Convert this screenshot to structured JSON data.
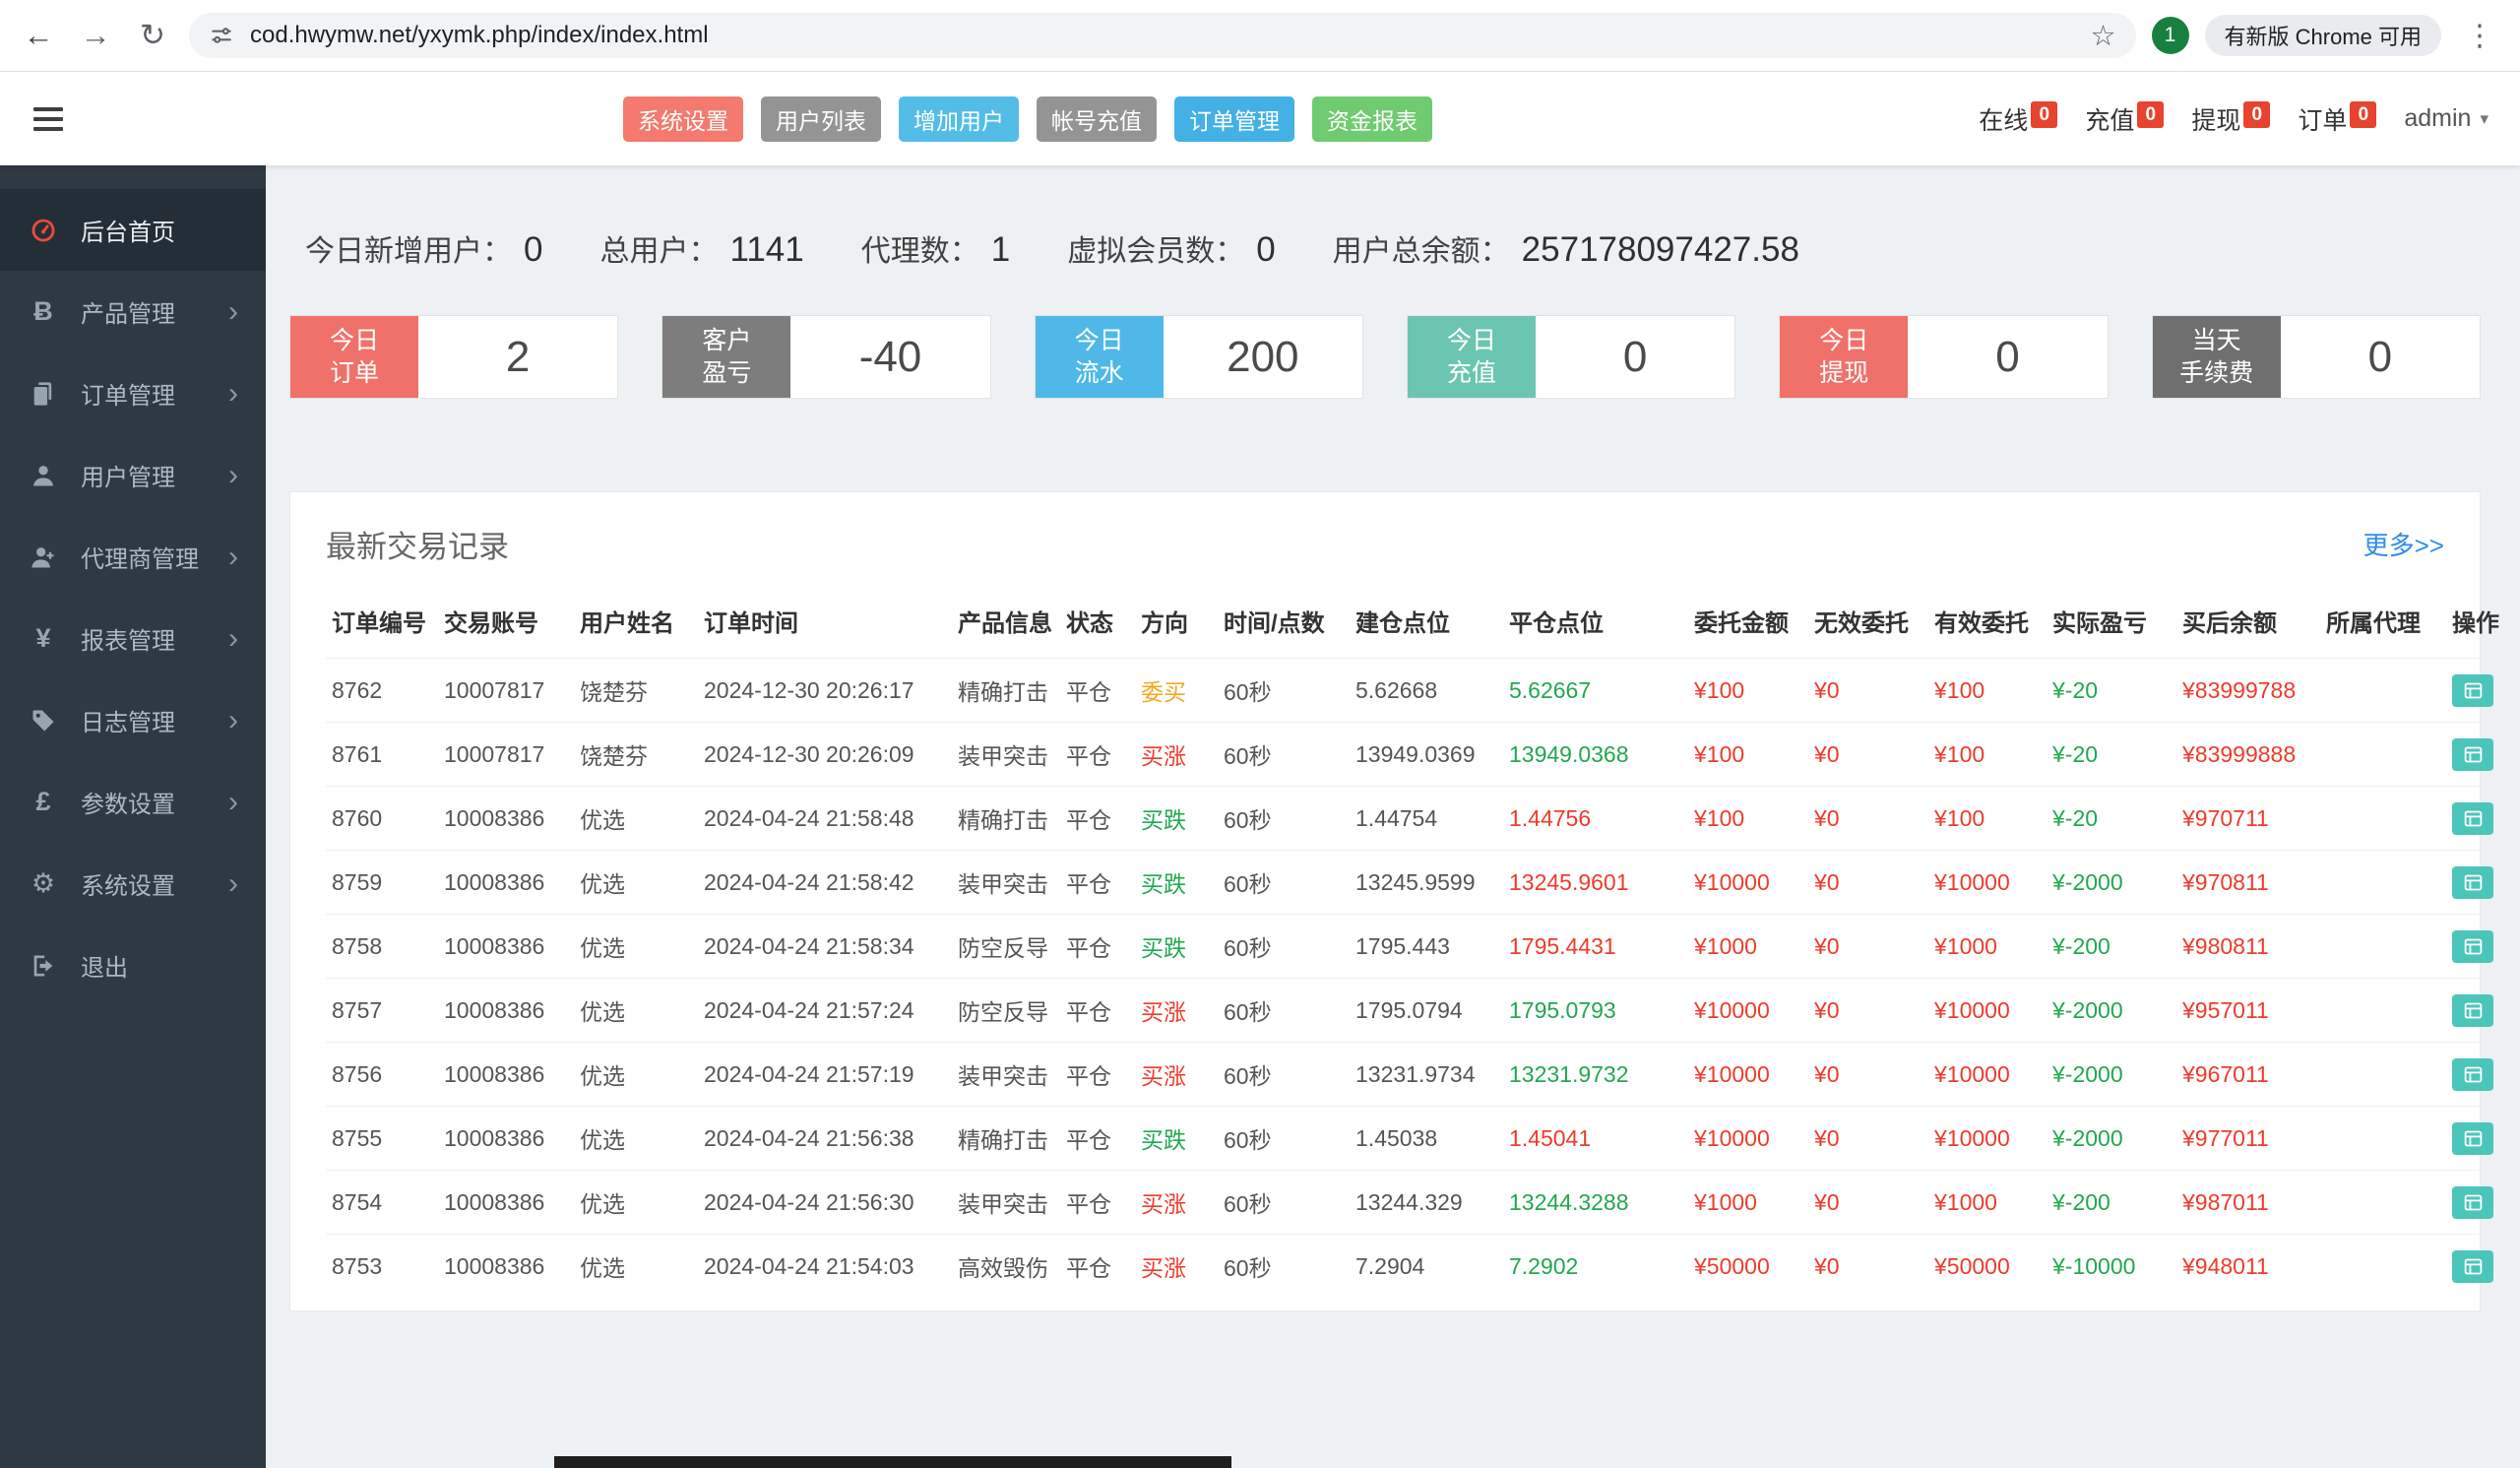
{
  "browser": {
    "url": "cod.hwymw.net/yxymk.php/index/index.html",
    "profile_initial": "1",
    "update_label": "有新版 Chrome 可用"
  },
  "header": {
    "quick_actions": [
      {
        "id": "system-settings",
        "label": "系统设置",
        "color": "#f4796e"
      },
      {
        "id": "user-list",
        "label": "用户列表",
        "color": "#949494"
      },
      {
        "id": "add-user",
        "label": "增加用户",
        "color": "#53bde8"
      },
      {
        "id": "account-recharge",
        "label": "帐号充值",
        "color": "#949494"
      },
      {
        "id": "order-management",
        "label": "订单管理",
        "color": "#43b0e6"
      },
      {
        "id": "funds-report",
        "label": "资金报表",
        "color": "#6fcb6f"
      }
    ],
    "status_items": [
      {
        "id": "online",
        "label": "在线",
        "count": "0"
      },
      {
        "id": "recharge",
        "label": "充值",
        "count": "0"
      },
      {
        "id": "withdraw",
        "label": "提现",
        "count": "0"
      },
      {
        "id": "orders",
        "label": "订单",
        "count": "0"
      }
    ],
    "user_menu": {
      "label": "admin"
    }
  },
  "sidebar": {
    "items": [
      {
        "id": "home",
        "label": "后台首页",
        "icon": "dashboard-icon",
        "active": true,
        "expandable": false
      },
      {
        "id": "products",
        "label": "产品管理",
        "icon": "bitcoin-icon",
        "active": false,
        "expandable": true
      },
      {
        "id": "orders",
        "label": "订单管理",
        "icon": "orders-icon",
        "active": false,
        "expandable": true
      },
      {
        "id": "users",
        "label": "用户管理",
        "icon": "users-icon",
        "active": false,
        "expandable": true
      },
      {
        "id": "agents",
        "label": "代理商管理",
        "icon": "agents-icon",
        "active": false,
        "expandable": true
      },
      {
        "id": "reports",
        "label": "报表管理",
        "icon": "reports-icon",
        "active": false,
        "expandable": true
      },
      {
        "id": "logs",
        "label": "日志管理",
        "icon": "logs-icon",
        "active": false,
        "expandable": true
      },
      {
        "id": "params",
        "label": "参数设置",
        "icon": "params-icon",
        "active": false,
        "expandable": true
      },
      {
        "id": "system",
        "label": "系统设置",
        "icon": "system-icon",
        "active": false,
        "expandable": true
      },
      {
        "id": "logout",
        "label": "退出",
        "icon": "logout-icon",
        "active": false,
        "expandable": false
      }
    ]
  },
  "stats": [
    {
      "label": "今日新增用户：",
      "value": "0"
    },
    {
      "label": "总用户：",
      "value": "1141"
    },
    {
      "label": "代理数：",
      "value": "1"
    },
    {
      "label": "虚拟会员数：",
      "value": "0"
    },
    {
      "label": "用户总余额：",
      "value": "257178097427.58"
    }
  ],
  "cards": [
    {
      "id": "today-orders",
      "lines": [
        "今日",
        "订单"
      ],
      "color": "#f0716a",
      "value": "2"
    },
    {
      "id": "customer-pnl",
      "lines": [
        "客户",
        "盈亏"
      ],
      "color": "#7d7d7d",
      "value": "-40"
    },
    {
      "id": "today-turnover",
      "lines": [
        "今日",
        "流水"
      ],
      "color": "#4fb8e8",
      "value": "200"
    },
    {
      "id": "today-recharge",
      "lines": [
        "今日",
        "充值"
      ],
      "color": "#6cc5b1",
      "value": "0"
    },
    {
      "id": "today-withdraw",
      "lines": [
        "今日",
        "提现"
      ],
      "color": "#f0716a",
      "value": "0"
    },
    {
      "id": "today-fees",
      "lines": [
        "当天",
        "手续费"
      ],
      "color": "#6f6f6f",
      "value": "0"
    }
  ],
  "table": {
    "title": "最新交易记录",
    "more_label": "更多>>",
    "columns": [
      {
        "key": "id",
        "label": "订单编号"
      },
      {
        "key": "account",
        "label": "交易账号"
      },
      {
        "key": "name",
        "label": "用户姓名"
      },
      {
        "key": "time",
        "label": "订单时间"
      },
      {
        "key": "product",
        "label": "产品信息"
      },
      {
        "key": "status",
        "label": "状态"
      },
      {
        "key": "direction",
        "label": "方向",
        "colorKey": "direction_color"
      },
      {
        "key": "period",
        "label": "时间/点数"
      },
      {
        "key": "open",
        "label": "建仓点位"
      },
      {
        "key": "close",
        "label": "平仓点位",
        "colorKey": "close_color"
      },
      {
        "key": "amount",
        "label": "委托金额",
        "color": "red"
      },
      {
        "key": "invalid",
        "label": "无效委托",
        "color": "red"
      },
      {
        "key": "valid",
        "label": "有效委托",
        "color": "red"
      },
      {
        "key": "profit",
        "label": "实际盈亏",
        "color": "green"
      },
      {
        "key": "balance",
        "label": "买后余额",
        "color": "red"
      },
      {
        "key": "agent",
        "label": "所属代理"
      },
      {
        "key": "action",
        "label": "操作"
      }
    ],
    "rows": [
      {
        "id": "8762",
        "account": "10007817",
        "name": "饶楚芬",
        "time": "2024-12-30 20:26:17",
        "product": "精确打击",
        "status": "平仓",
        "direction": "委买",
        "direction_color": "orange",
        "period": "60秒",
        "open": "5.62668",
        "close": "5.62667",
        "close_color": "green",
        "amount": "¥100",
        "invalid": "¥0",
        "valid": "¥100",
        "profit": "¥-20",
        "balance": "¥83999788",
        "agent": ""
      },
      {
        "id": "8761",
        "account": "10007817",
        "name": "饶楚芬",
        "time": "2024-12-30 20:26:09",
        "product": "装甲突击",
        "status": "平仓",
        "direction": "买涨",
        "direction_color": "red",
        "period": "60秒",
        "open": "13949.0369",
        "close": "13949.0368",
        "close_color": "green",
        "amount": "¥100",
        "invalid": "¥0",
        "valid": "¥100",
        "profit": "¥-20",
        "balance": "¥83999888",
        "agent": ""
      },
      {
        "id": "8760",
        "account": "10008386",
        "name": "优选",
        "time": "2024-04-24 21:58:48",
        "product": "精确打击",
        "status": "平仓",
        "direction": "买跌",
        "direction_color": "green",
        "period": "60秒",
        "open": "1.44754",
        "close": "1.44756",
        "close_color": "red",
        "amount": "¥100",
        "invalid": "¥0",
        "valid": "¥100",
        "profit": "¥-20",
        "balance": "¥970711",
        "agent": ""
      },
      {
        "id": "8759",
        "account": "10008386",
        "name": "优选",
        "time": "2024-04-24 21:58:42",
        "product": "装甲突击",
        "status": "平仓",
        "direction": "买跌",
        "direction_color": "green",
        "period": "60秒",
        "open": "13245.9599",
        "close": "13245.9601",
        "close_color": "red",
        "amount": "¥10000",
        "invalid": "¥0",
        "valid": "¥10000",
        "profit": "¥-2000",
        "balance": "¥970811",
        "agent": ""
      },
      {
        "id": "8758",
        "account": "10008386",
        "name": "优选",
        "time": "2024-04-24 21:58:34",
        "product": "防空反导",
        "status": "平仓",
        "direction": "买跌",
        "direction_color": "green",
        "period": "60秒",
        "open": "1795.443",
        "close": "1795.4431",
        "close_color": "red",
        "amount": "¥1000",
        "invalid": "¥0",
        "valid": "¥1000",
        "profit": "¥-200",
        "balance": "¥980811",
        "agent": ""
      },
      {
        "id": "8757",
        "account": "10008386",
        "name": "优选",
        "time": "2024-04-24 21:57:24",
        "product": "防空反导",
        "status": "平仓",
        "direction": "买涨",
        "direction_color": "red",
        "period": "60秒",
        "open": "1795.0794",
        "close": "1795.0793",
        "close_color": "green",
        "amount": "¥10000",
        "invalid": "¥0",
        "valid": "¥10000",
        "profit": "¥-2000",
        "balance": "¥957011",
        "agent": ""
      },
      {
        "id": "8756",
        "account": "10008386",
        "name": "优选",
        "time": "2024-04-24 21:57:19",
        "product": "装甲突击",
        "status": "平仓",
        "direction": "买涨",
        "direction_color": "red",
        "period": "60秒",
        "open": "13231.9734",
        "close": "13231.9732",
        "close_color": "green",
        "amount": "¥10000",
        "invalid": "¥0",
        "valid": "¥10000",
        "profit": "¥-2000",
        "balance": "¥967011",
        "agent": ""
      },
      {
        "id": "8755",
        "account": "10008386",
        "name": "优选",
        "time": "2024-04-24 21:56:38",
        "product": "精确打击",
        "status": "平仓",
        "direction": "买跌",
        "direction_color": "green",
        "period": "60秒",
        "open": "1.45038",
        "close": "1.45041",
        "close_color": "red",
        "amount": "¥10000",
        "invalid": "¥0",
        "valid": "¥10000",
        "profit": "¥-2000",
        "balance": "¥977011",
        "agent": ""
      },
      {
        "id": "8754",
        "account": "10008386",
        "name": "优选",
        "time": "2024-04-24 21:56:30",
        "product": "装甲突击",
        "status": "平仓",
        "direction": "买涨",
        "direction_color": "red",
        "period": "60秒",
        "open": "13244.329",
        "close": "13244.3288",
        "close_color": "green",
        "amount": "¥1000",
        "invalid": "¥0",
        "valid": "¥1000",
        "profit": "¥-200",
        "balance": "¥987011",
        "agent": ""
      },
      {
        "id": "8753",
        "account": "10008386",
        "name": "优选",
        "time": "2024-04-24 21:54:03",
        "product": "高效毁伤",
        "status": "平仓",
        "direction": "买涨",
        "direction_color": "red",
        "period": "60秒",
        "open": "7.2904",
        "close": "7.2902",
        "close_color": "green",
        "amount": "¥50000",
        "invalid": "¥0",
        "valid": "¥50000",
        "profit": "¥-10000",
        "balance": "¥948011",
        "agent": ""
      }
    ]
  },
  "colors": {
    "red": "#ef3b2a",
    "green": "#21a84f",
    "orange": "#f5a623"
  }
}
